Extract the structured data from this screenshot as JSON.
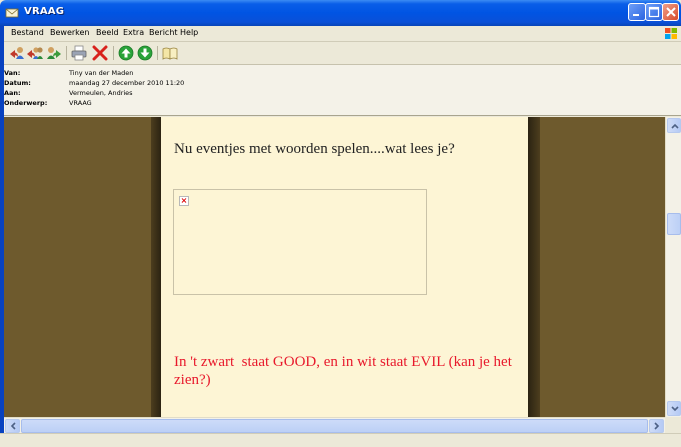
{
  "window": {
    "title": "VRAAG",
    "icon": "envelope-icon",
    "controls": [
      "minimize-icon",
      "maximize-icon",
      "close-icon"
    ]
  },
  "menu": {
    "items": [
      "Bestand",
      "Bewerken",
      "Beeld",
      "Extra",
      "Bericht",
      "Help"
    ]
  },
  "toolbar": {
    "icons": [
      "reply-icon",
      "reply-all-icon",
      "forward-icon",
      "print-icon",
      "delete-icon",
      "previous-icon",
      "next-icon",
      "addresses-icon"
    ]
  },
  "header": {
    "from_label": "Van:",
    "from_value": "Tiny van der Maden",
    "date_label": "Datum:",
    "date_value": "maandag 27 december 2010 11:20",
    "to_label": "Aan:",
    "to_value": "Vermeulen, Andries",
    "subject_label": "Onderwerp:",
    "subject_value": "VRAAG"
  },
  "message": {
    "line1": "Nu eventjes met woorden spelen....wat lees je?",
    "image_status": "broken-image-icon",
    "red_text": "In 't zwart  staat GOOD, en in wit staat EVIL (kan je het zien?)",
    "colors": {
      "page_background": "#fdf5d5",
      "outer_background": "#6e5a2d",
      "red_text": "#e8192c"
    }
  }
}
